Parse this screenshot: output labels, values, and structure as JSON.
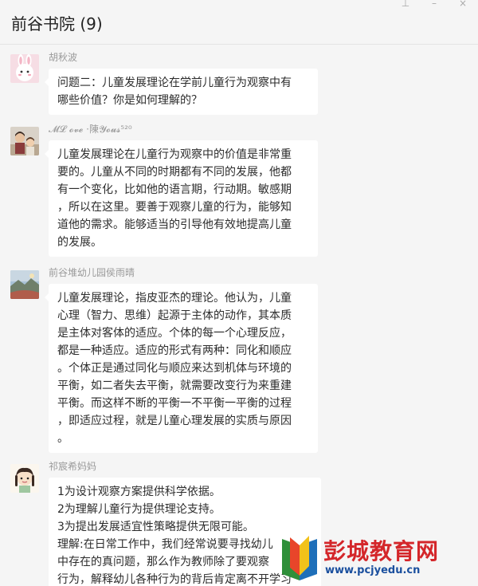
{
  "header": {
    "title": "前谷书院 (9)",
    "pin_icon": "pin-icon",
    "minimize_icon": "minimize-icon",
    "close_icon": "close-icon"
  },
  "messages": [
    {
      "sender": "胡秋波",
      "avatar": "cartoon-rabbit-avatar",
      "lines": [
        "问题二：儿童发展理论在学前儿童行为观察中有",
        "哪些价值？你是如何理解的？"
      ]
    },
    {
      "sender": "𝓜𝓛 𝓸𝓿𝓮 ·陳𝓨𝓸𝓾𝓼⁵²⁰",
      "avatar": "family-photo-avatar",
      "lines": [
        "儿童发展理论在儿童行为观察中的价值是非常重",
        "要的。儿童从不同的时期都有不同的发展，他都",
        "有一个变化，比如他的语言期，行动期。敏感期",
        "，所以在这里。要善于观察儿童的行为，能够知",
        "道他的需求。能够适当的引导他有效地提高儿童",
        "的发展。"
      ]
    },
    {
      "sender": "前谷堆幼儿园侯雨晴",
      "avatar": "landscape-avatar",
      "lines": [
        "儿童发展理论，指皮亚杰的理论。他认为，儿童",
        "心理（智力、思维）起源于主体的动作，其本质",
        "是主体对客体的适应。个体的每一个心理反应，",
        "都是一种适应。适应的形式有两种：同化和顺应",
        "。个体正是通过同化与顺应来达到机体与环境的",
        "平衡，如二者失去平衡，就需要改变行为来重建",
        "平衡。而这样不断的平衡一不平衡一平衡的过程",
        "，即适应过程，就是儿童心理发展的实质与原因",
        "。"
      ]
    },
    {
      "sender": "祁宸希妈妈",
      "avatar": "cartoon-girl-avatar",
      "lines": [
        "1为设计观察方案提供科学依据。",
        "2为理解儿童行为提供理论支持。",
        "3为提出发展适宜性策略提供无限可能。",
        "理解:在日常工作中，我们经常说要寻找幼儿",
        "中存在的真问题，那么作为教师除了要观察",
        "行为，解释幼儿各种行为的背后肯定离不开学习"
      ]
    }
  ],
  "watermark": {
    "name": "彭城教育网",
    "url": "www.pcjyedu.cn",
    "colors": {
      "name": "#d4262a",
      "url": "#1a4f9e"
    }
  },
  "colors": {
    "background": "#f5f5f5",
    "bubble": "#ffffff",
    "text": "#2c2c2c",
    "sender": "#9a9a9a"
  }
}
